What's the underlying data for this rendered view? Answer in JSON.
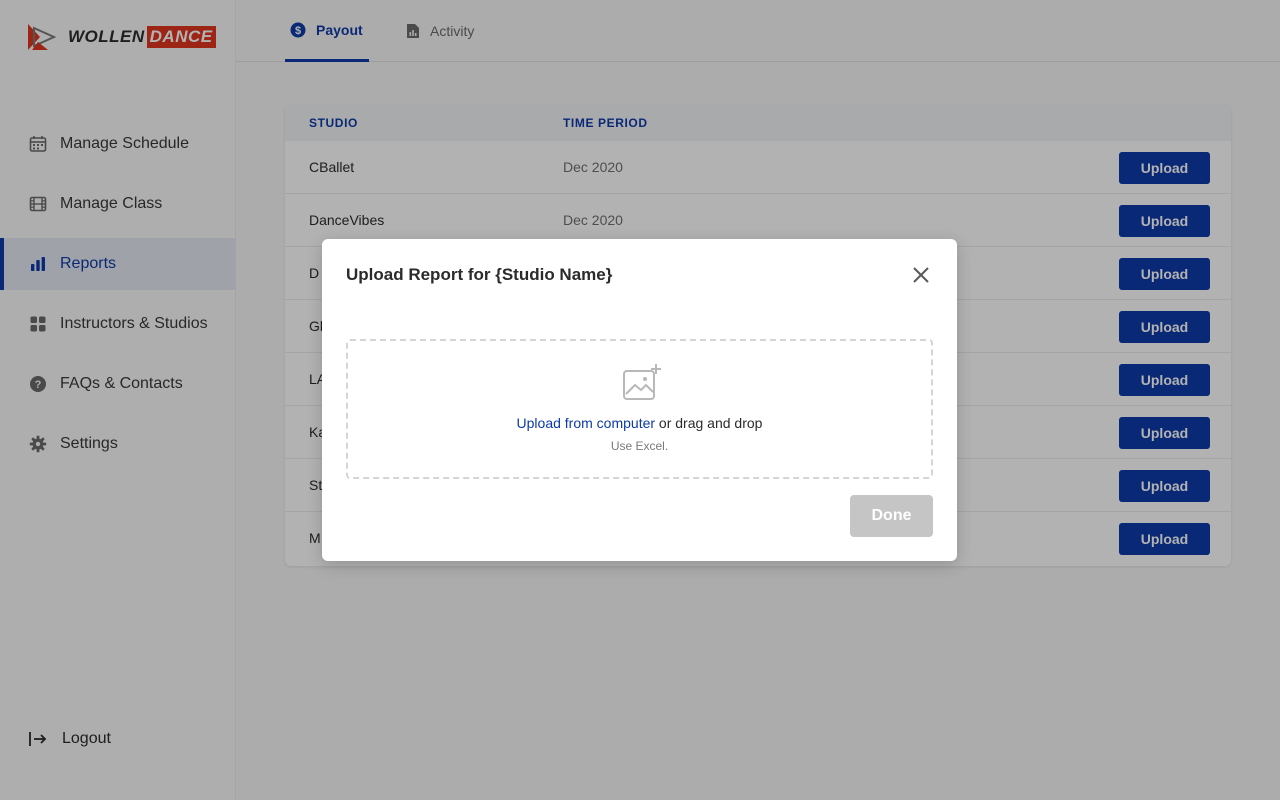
{
  "brand": {
    "word1": "WOLLEN",
    "word2": "DANCE",
    "accent": "#e0361f",
    "primary": "#0d3aa8"
  },
  "sidebar": {
    "items": [
      {
        "label": "Manage Schedule",
        "icon": "calendar-icon",
        "active": false
      },
      {
        "label": "Manage Class",
        "icon": "film-icon",
        "active": false
      },
      {
        "label": "Reports",
        "icon": "bar-chart-icon",
        "active": true
      },
      {
        "label": "Instructors & Studios",
        "icon": "grid-icon",
        "active": false
      },
      {
        "label": "FAQs & Contacts",
        "icon": "question-icon",
        "active": false
      },
      {
        "label": "Settings",
        "icon": "gear-icon",
        "active": false
      }
    ],
    "logout": "Logout"
  },
  "tabs": [
    {
      "label": "Payout",
      "icon": "dollar-circle-icon",
      "active": true
    },
    {
      "label": "Activity",
      "icon": "document-chart-icon",
      "active": false
    }
  ],
  "table": {
    "headers": {
      "studio": "STUDIO",
      "period": "TIME PERIOD"
    },
    "action_label": "Upload",
    "rows": [
      {
        "studio": "CBallet",
        "period": "Dec 2020"
      },
      {
        "studio": "DanceVibes",
        "period": "Dec 2020"
      },
      {
        "studio": "D",
        "period": ""
      },
      {
        "studio": "Gl",
        "period": ""
      },
      {
        "studio": "LA",
        "period": ""
      },
      {
        "studio": "Ka",
        "period": ""
      },
      {
        "studio": "St",
        "period": ""
      },
      {
        "studio": "M",
        "period": ""
      }
    ]
  },
  "modal": {
    "title": "Upload Report for {Studio Name}",
    "upload_link": "Upload from computer",
    "upload_rest": " or drag and drop",
    "hint": "Use Excel.",
    "done_label": "Done"
  }
}
